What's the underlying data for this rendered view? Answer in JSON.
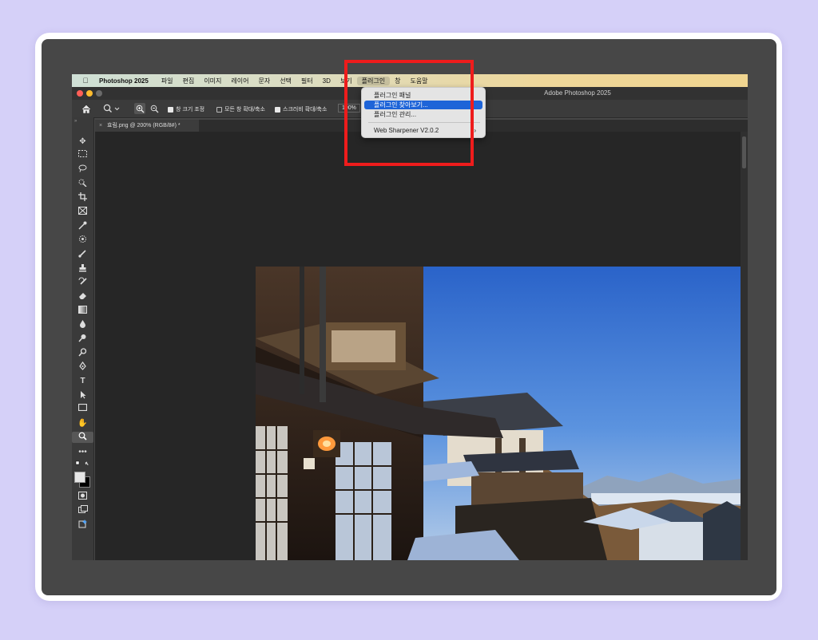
{
  "menubar": {
    "app_name": "Photoshop 2025",
    "items": [
      "파일",
      "편집",
      "이미지",
      "레이어",
      "문자",
      "선택",
      "필터",
      "3D",
      "보기",
      "플러그인",
      "창",
      "도움말"
    ],
    "active_item": "플러그인"
  },
  "window": {
    "title": "Adobe Photoshop 2025"
  },
  "options_bar": {
    "resize_windows_label": "창 크기 조정",
    "zoom_all_windows_label": "모든 창 확대/축소",
    "scrubby_zoom_label": "스크러비 확대/축소",
    "zoom_value": "100%"
  },
  "document_tab": {
    "close": "×",
    "label": "효림.png @ 200% (RGB/8#) *"
  },
  "plugin_menu": {
    "items": [
      "플러그인 패널",
      "플러그인 찾아보기...",
      "플러그인 관리...",
      "Web Sharpener V2.0.2"
    ],
    "highlighted_index": 1,
    "submenu_arrow": "›"
  },
  "colors": {
    "background": "#d5d0f8",
    "annotation_red": "#ee1c1c",
    "highlight_blue": "#1e64d8"
  }
}
